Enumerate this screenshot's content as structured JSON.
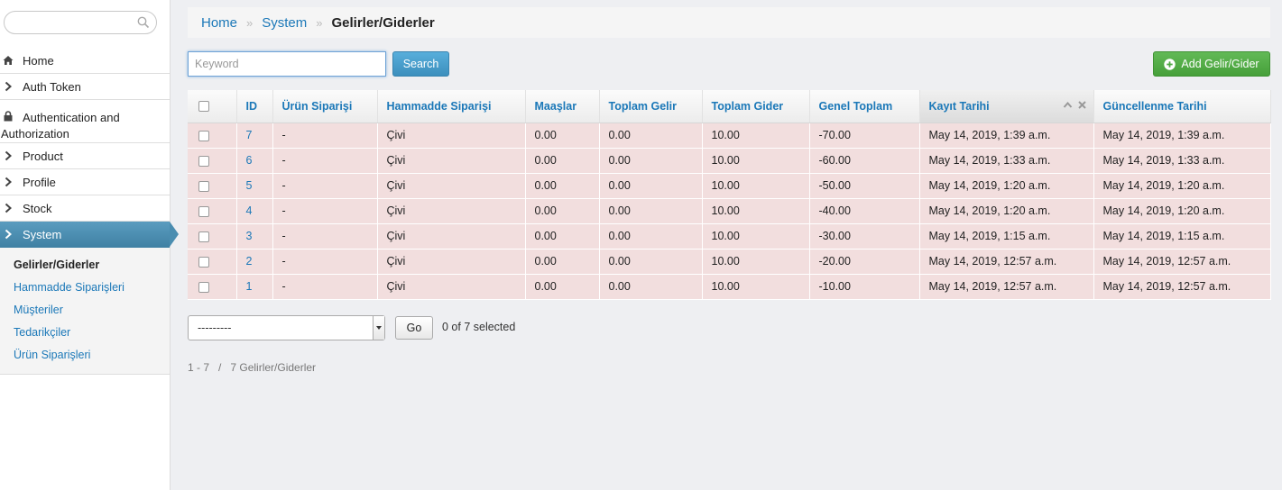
{
  "sidebar": {
    "search_placeholder": "",
    "menu": [
      {
        "label": "Home",
        "icon": "home-icon"
      },
      {
        "label": "Auth Token",
        "icon": "chevron-right-icon"
      },
      {
        "label_line1": "Authentication and",
        "label_line2": "Authorization",
        "icon": "lock-icon"
      },
      {
        "label": "Product",
        "icon": "chevron-right-icon"
      },
      {
        "label": "Profile",
        "icon": "chevron-right-icon"
      },
      {
        "label": "Stock",
        "icon": "chevron-right-icon"
      },
      {
        "label": "System",
        "icon": "chevron-right-icon",
        "active": true
      }
    ],
    "submenu": [
      {
        "label": "Gelirler/Giderler",
        "current": true
      },
      {
        "label": "Hammadde Siparişleri"
      },
      {
        "label": "Müşteriler"
      },
      {
        "label": "Tedarikçiler"
      },
      {
        "label": "Ürün Siparişleri"
      }
    ]
  },
  "breadcrumb": {
    "home": "Home",
    "separator": "»",
    "system": "System",
    "current": "Gelirler/Giderler"
  },
  "toolbar": {
    "keyword_placeholder": "Keyword",
    "search_label": "Search",
    "add_label": "Add Gelir/Gider"
  },
  "table": {
    "columns": [
      "ID",
      "Ürün Siparişi",
      "Hammadde Siparişi",
      "Maaşlar",
      "Toplam Gelir",
      "Toplam Gider",
      "Genel Toplam",
      "Kayıt Tarihi",
      "Güncellenme Tarihi"
    ],
    "rows": [
      [
        "7",
        "-",
        "Çivi",
        "0.00",
        "0.00",
        "10.00",
        "-70.00",
        "May 14, 2019, 1:39 a.m.",
        "May 14, 2019, 1:39 a.m."
      ],
      [
        "6",
        "-",
        "Çivi",
        "0.00",
        "0.00",
        "10.00",
        "-60.00",
        "May 14, 2019, 1:33 a.m.",
        "May 14, 2019, 1:33 a.m."
      ],
      [
        "5",
        "-",
        "Çivi",
        "0.00",
        "0.00",
        "10.00",
        "-50.00",
        "May 14, 2019, 1:20 a.m.",
        "May 14, 2019, 1:20 a.m."
      ],
      [
        "4",
        "-",
        "Çivi",
        "0.00",
        "0.00",
        "10.00",
        "-40.00",
        "May 14, 2019, 1:20 a.m.",
        "May 14, 2019, 1:20 a.m."
      ],
      [
        "3",
        "-",
        "Çivi",
        "0.00",
        "0.00",
        "10.00",
        "-30.00",
        "May 14, 2019, 1:15 a.m.",
        "May 14, 2019, 1:15 a.m."
      ],
      [
        "2",
        "-",
        "Çivi",
        "0.00",
        "0.00",
        "10.00",
        "-20.00",
        "May 14, 2019, 12:57 a.m.",
        "May 14, 2019, 12:57 a.m."
      ],
      [
        "1",
        "-",
        "Çivi",
        "0.00",
        "0.00",
        "10.00",
        "-10.00",
        "May 14, 2019, 12:57 a.m.",
        "May 14, 2019, 12:57 a.m."
      ]
    ]
  },
  "actions": {
    "select_value": "---------",
    "go_label": "Go",
    "selected_text": "0 of 7 selected"
  },
  "pagination": {
    "text": "1 - 7   /   7 Gelirler/Giderler"
  },
  "colors": {
    "row_bg": "#f2dede",
    "link": "#1b78b8",
    "active_menu": "#4a8db0",
    "add_button": "#5cb85c",
    "search_button": "#4a9fcb"
  }
}
